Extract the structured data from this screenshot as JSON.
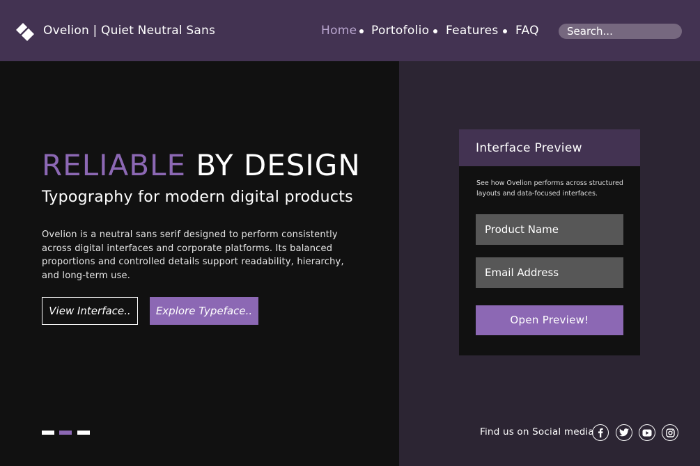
{
  "header": {
    "brand": "Ovelion | Quiet Neutral Sans",
    "nav": [
      {
        "label": "Home",
        "active": true
      },
      {
        "label": "Portofolio"
      },
      {
        "label": "Features"
      },
      {
        "label": "FAQ"
      }
    ],
    "search_placeholder": "Search..."
  },
  "hero": {
    "title_accent": "RELIABLE",
    "title_rest": "BY DESIGN",
    "subtitle": "Typography for modern digital products",
    "body": "Ovelion is a neutral sans serif designed to perform consistently across digital interfaces and corporate platforms. Its balanced proportions and controlled details support readability, hierarchy, and long-term use.",
    "btn_view": "View Interface..",
    "btn_explore": "Explore Typeface..",
    "slides": [
      {
        "active": false
      },
      {
        "active": true
      },
      {
        "active": false
      }
    ]
  },
  "preview": {
    "title": "Interface Preview",
    "description": "See how Ovelion performs across structured layouts and data-focused interfaces.",
    "field_product_placeholder": "Product Name",
    "field_email_placeholder": "Email Address",
    "button": "Open Preview!"
  },
  "social": {
    "label": "Find us on Social media",
    "icons": [
      "facebook-icon",
      "twitter-icon",
      "youtube-icon",
      "instagram-icon"
    ]
  },
  "colors": {
    "header_bg": "#433352",
    "accent": "#8c68b4",
    "nav_active": "#b9a6cf",
    "left_bg": "#111111",
    "right_bg": "#2c2533",
    "field_bg": "#575757"
  }
}
